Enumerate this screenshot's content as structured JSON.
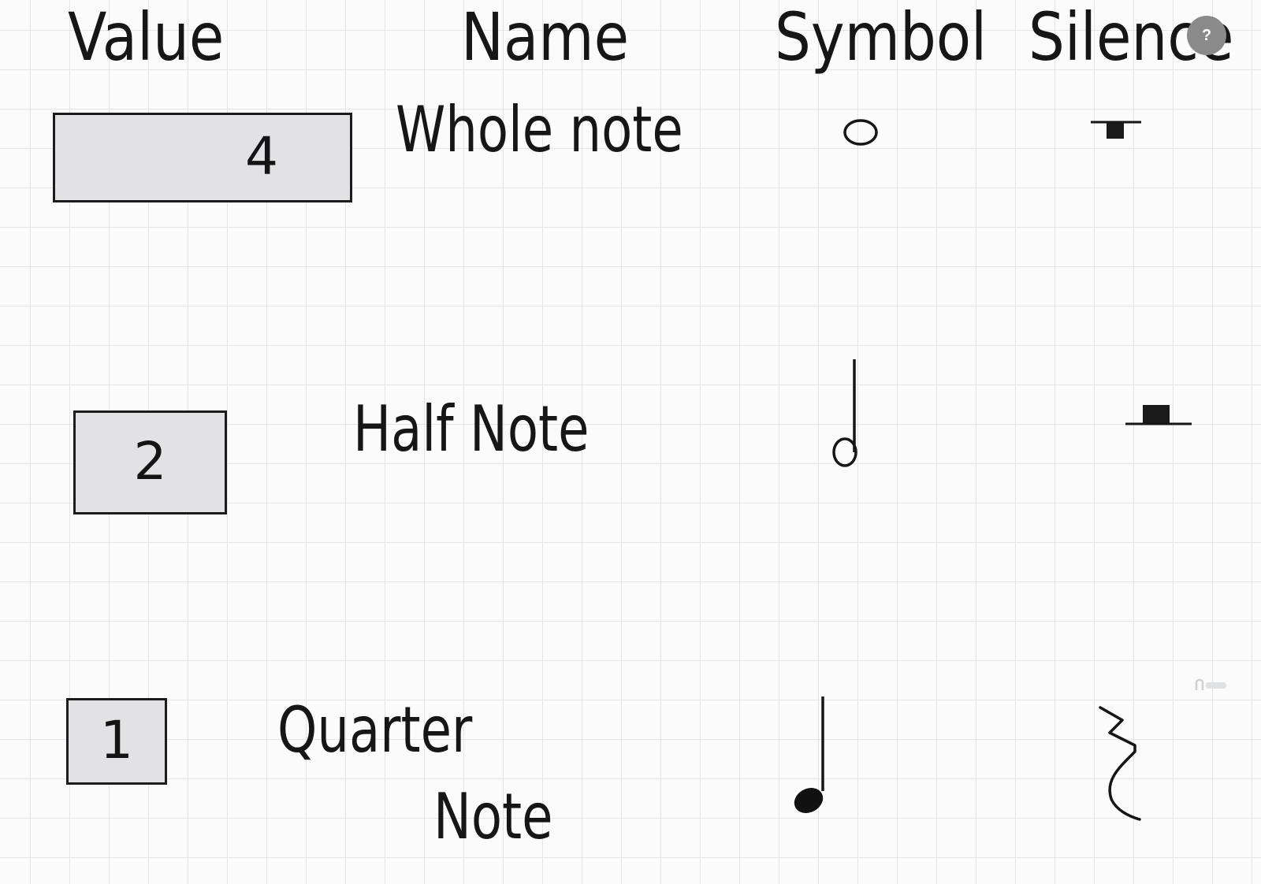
{
  "headers": {
    "value": "Value",
    "name": "Name",
    "symbol": "Symbol",
    "silence": "Silence"
  },
  "rows": [
    {
      "value": "4",
      "name": "Whole note",
      "symbol_icon": "whole-note-icon",
      "rest_icon": "whole-rest-icon"
    },
    {
      "value": "2",
      "name": "Half Note",
      "symbol_icon": "half-note-icon",
      "rest_icon": "half-rest-icon"
    },
    {
      "value": "1",
      "name_line1": "Quarter",
      "name_line2": "Note",
      "symbol_icon": "quarter-note-icon",
      "rest_icon": "quarter-rest-icon"
    }
  ],
  "help_button": {
    "label": "?"
  },
  "watermark": {
    "logo": "udemy-logo"
  },
  "colors": {
    "ink": "#161616",
    "box_fill": "#e2e2e4",
    "grid_line": "#e4e6e6",
    "paper": "#fbfbfb"
  }
}
